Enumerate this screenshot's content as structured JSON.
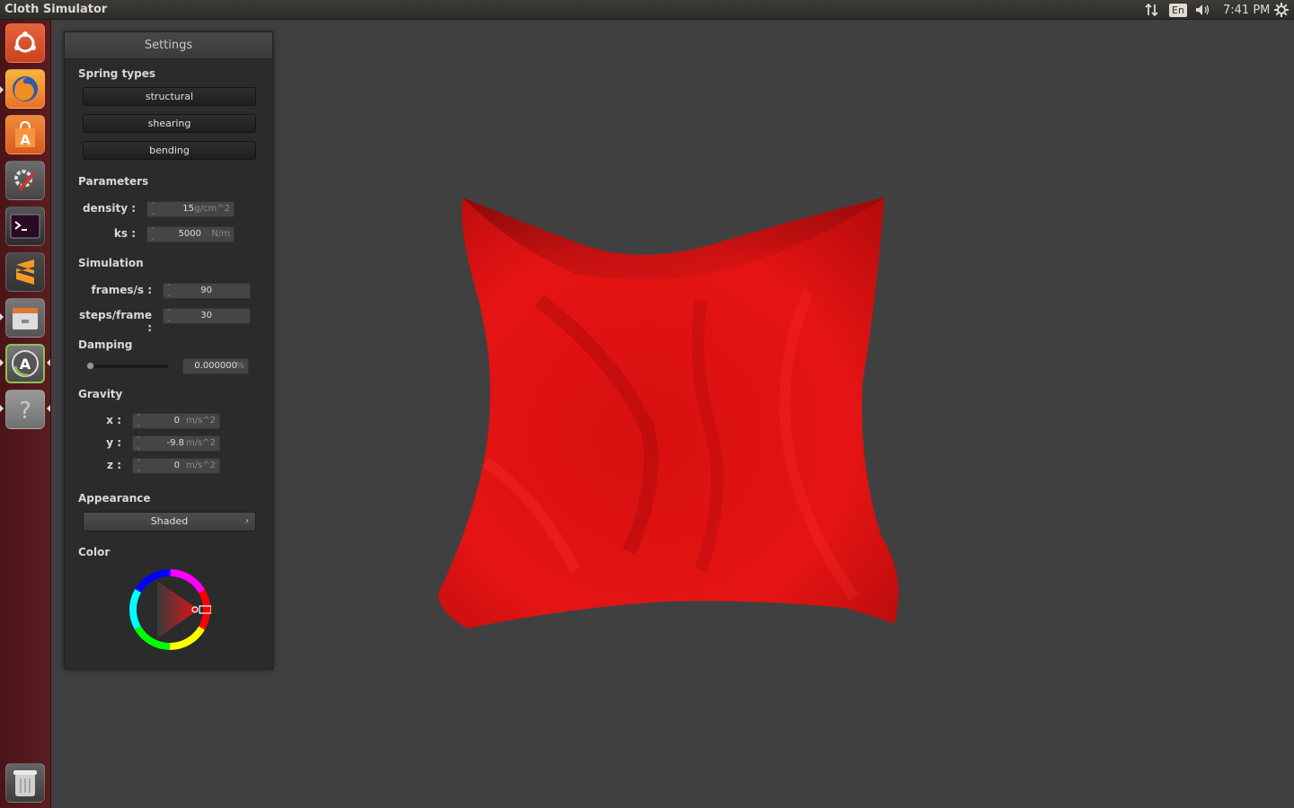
{
  "window": {
    "title": "Cloth Simulator"
  },
  "tray": {
    "lang": "En",
    "time": "7:41 PM",
    "icons": [
      "network-arrows-icon",
      "volume-icon",
      "power-gear-icon"
    ]
  },
  "launcher": {
    "items": [
      "ubuntu-dash-icon",
      "firefox-icon",
      "software-center-icon",
      "system-settings-icon",
      "terminal-icon",
      "sublime-text-icon",
      "files-icon",
      "software-updater-icon",
      "help-icon",
      "trash-icon"
    ]
  },
  "settings": {
    "title": "Settings",
    "spring_types": {
      "label": "Spring types",
      "buttons": [
        "structural",
        "shearing",
        "bending"
      ]
    },
    "parameters": {
      "label": "Parameters",
      "density": {
        "label": "density :",
        "value": "15",
        "unit": "g/cm^2"
      },
      "ks": {
        "label": "ks :",
        "value": "5000",
        "unit": "N/m"
      }
    },
    "simulation": {
      "label": "Simulation",
      "fps": {
        "label": "frames/s :",
        "value": "90"
      },
      "steps": {
        "label": "steps/frame :",
        "value": "30"
      }
    },
    "damping": {
      "label": "Damping",
      "value": "0.000000",
      "unit": "%",
      "slider_level": 0
    },
    "gravity": {
      "label": "Gravity",
      "x": {
        "label": "x :",
        "value": "0",
        "unit": "m/s^2"
      },
      "y": {
        "label": "y :",
        "value": "-9.8",
        "unit": "m/s^2"
      },
      "z": {
        "label": "z :",
        "value": "0",
        "unit": "m/s^2"
      }
    },
    "appearance": {
      "label": "Appearance",
      "selected": "Shaded"
    },
    "color": {
      "label": "Color",
      "value": "#e51414"
    }
  },
  "viewport": {
    "background": "#404040",
    "cloth_color": "#e51414"
  }
}
